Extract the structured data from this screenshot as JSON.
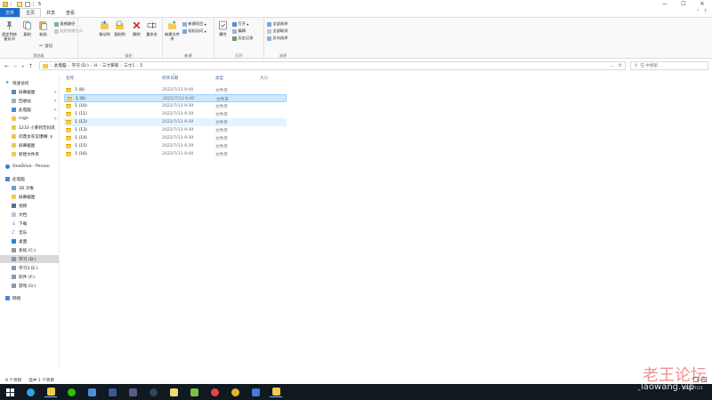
{
  "window": {
    "title": "5",
    "minimize": "—",
    "maximize": "☐",
    "close": "✕"
  },
  "ribbon_tabs": [
    {
      "label": "文件"
    },
    {
      "label": "主页"
    },
    {
      "label": "共享"
    },
    {
      "label": "查看"
    }
  ],
  "ribbon": {
    "clipboard": {
      "label": "剪贴板",
      "pin": "固定到快速访问",
      "copy": "复制",
      "paste": "粘贴",
      "copy_path": "复制路径",
      "paste_shortcut": "粘贴快捷方式",
      "cut": "剪切"
    },
    "organize": {
      "label": "组织",
      "move_to": "移动到",
      "copy_to": "复制到",
      "delete": "删除",
      "rename": "重命名"
    },
    "new": {
      "label": "新建",
      "new_folder": "新建文件夹",
      "new_item": "新建项目",
      "easy_access": "轻松访问"
    },
    "open": {
      "label": "打开",
      "properties": "属性",
      "open": "打开",
      "edit": "编辑",
      "history": "历史记录"
    },
    "select": {
      "label": "选择",
      "select_all": "全部选择",
      "select_none": "全部取消",
      "invert": "反向选择"
    }
  },
  "address": {
    "crumbs": [
      "此电脑",
      "学习 (D:)",
      "H",
      "三寸萝莉",
      "三寸1",
      "5"
    ],
    "search_placeholder": "在 中搜索"
  },
  "nav": [
    {
      "label": "快速访问",
      "icon": "star-icon",
      "type": "header"
    },
    {
      "label": "屏幕截图",
      "icon": "screenshot-folder-icon",
      "pin": true
    },
    {
      "label": "回收站",
      "icon": "recycle-bin-icon",
      "pin": true
    },
    {
      "label": "此电脑",
      "icon": "computer-icon",
      "pin": true
    },
    {
      "label": "csgo",
      "icon": "folder-icon",
      "pin": true
    },
    {
      "label": "1233 小萝莉无码凤",
      "icon": "folder-icon"
    },
    {
      "label": "问鼎女农炭爆横: $",
      "icon": "folder-icon"
    },
    {
      "label": "屏幕截图",
      "icon": "folder-icon"
    },
    {
      "label": "新建文件夹",
      "icon": "folder-icon"
    },
    {
      "label": "OneDrive - Person",
      "icon": "onedrive-icon",
      "type": "header"
    },
    {
      "label": "此电脑",
      "icon": "computer-icon",
      "type": "header"
    },
    {
      "label": "3D 对象",
      "icon": "3d-objects-icon"
    },
    {
      "label": "屏幕截图",
      "icon": "folder-icon"
    },
    {
      "label": "视频",
      "icon": "video-icon"
    },
    {
      "label": "文档",
      "icon": "documents-icon"
    },
    {
      "label": "下载",
      "icon": "download-icon"
    },
    {
      "label": "音乐",
      "icon": "music-icon"
    },
    {
      "label": "桌面",
      "icon": "desktop-icon"
    },
    {
      "label": "系统 (C:)",
      "icon": "drive-icon"
    },
    {
      "label": "学习 (D:)",
      "icon": "drive-icon",
      "selected": true
    },
    {
      "label": "学习3 (E:)",
      "icon": "drive-icon"
    },
    {
      "label": "软件 (F:)",
      "icon": "drive-icon"
    },
    {
      "label": "游戏 (G:)",
      "icon": "drive-icon"
    },
    {
      "label": "网络",
      "icon": "network-icon",
      "type": "header"
    }
  ],
  "columns": {
    "name": "名称",
    "date": "修改日期",
    "type": "类型",
    "size": "大小"
  },
  "files": [
    {
      "name": "1 (8)",
      "date": "2022/7/13 9:40",
      "type": "文件夹"
    },
    {
      "name": "1 (9)",
      "date": "2022/7/13 9:40",
      "type": "文件夹",
      "selected": true
    },
    {
      "name": "1 (10)",
      "date": "2022/7/13 9:39",
      "type": "文件夹"
    },
    {
      "name": "1 (11)",
      "date": "2022/7/13 9:39",
      "type": "文件夹"
    },
    {
      "name": "1 (12)",
      "date": "2022/7/13 9:39",
      "type": "文件夹",
      "hover": true
    },
    {
      "name": "1 (13)",
      "date": "2022/7/13 9:39",
      "type": "文件夹"
    },
    {
      "name": "1 (14)",
      "date": "2022/7/13 9:39",
      "type": "文件夹"
    },
    {
      "name": "1 (15)",
      "date": "2022/7/13 9:39",
      "type": "文件夹"
    },
    {
      "name": "1 (16)",
      "date": "2022/7/13 9:40",
      "type": "文件夹"
    }
  ],
  "status": {
    "count": "9 个项目",
    "selected": "选中 1 个项目"
  },
  "taskbar": {
    "apps": [
      {
        "name": "start-button",
        "color": "#ffffff"
      },
      {
        "name": "edge-app",
        "color": "#2fa4e7"
      },
      {
        "name": "explorer-app",
        "color": "#f2c94c"
      },
      {
        "name": "wechat-app",
        "color": "#2dc100"
      },
      {
        "name": "app-5",
        "color": "#4a90d9"
      },
      {
        "name": "app-6",
        "color": "#3b5998"
      },
      {
        "name": "app-7",
        "color": "#5a5a8a"
      },
      {
        "name": "steam-app",
        "color": "#1b2838"
      },
      {
        "name": "app-9",
        "color": "#f5d76e"
      },
      {
        "name": "app-10",
        "color": "#7bbf4a"
      },
      {
        "name": "app-11",
        "color": "#e64545"
      },
      {
        "name": "chrome-app",
        "color": "#e8b22c"
      },
      {
        "name": "app-13",
        "color": "#3a7fd8"
      },
      {
        "name": "app-14",
        "color": "#f2c94c"
      }
    ],
    "tray_line": "2022/7/21",
    "tray_arrow": "^"
  },
  "watermark": {
    "top": "老王论坛",
    "bottom": "laowang.vip"
  }
}
